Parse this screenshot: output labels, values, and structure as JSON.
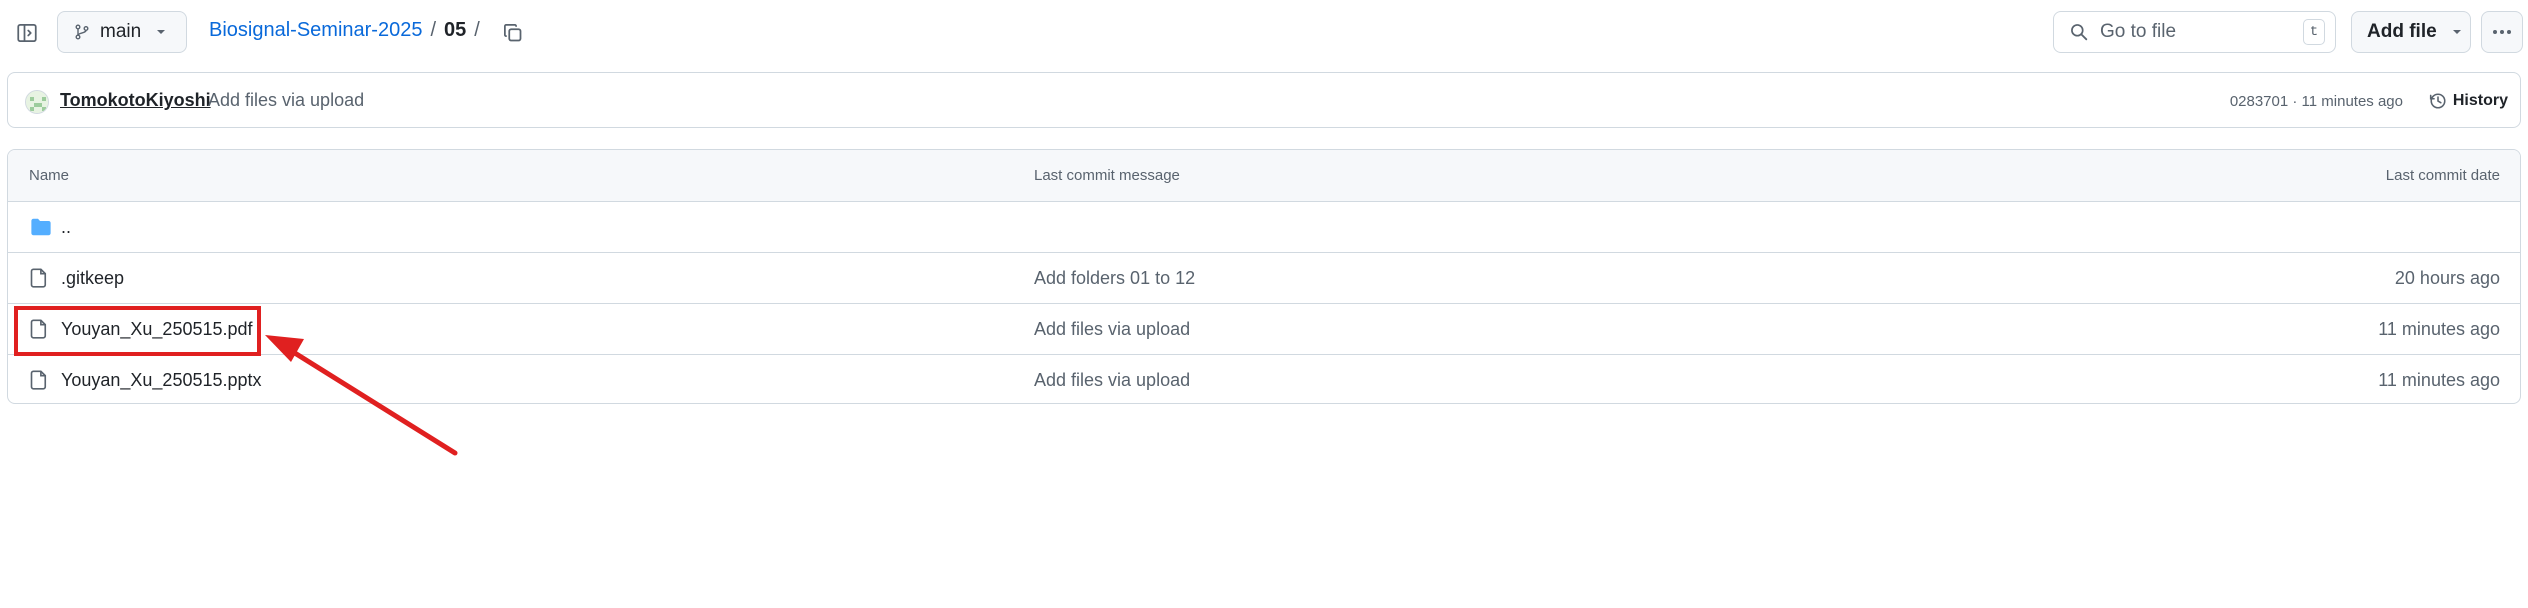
{
  "topbar": {
    "sidebar_toggle_icon": "sidebar-expand-icon",
    "branch": {
      "icon": "git-branch-icon",
      "label": "main"
    },
    "breadcrumb": {
      "repo": "Biosignal-Seminar-2025",
      "sep1": "/",
      "folder": "05",
      "sep2": "/"
    },
    "copy_icon": "copy-icon",
    "go_to_file": {
      "placeholder": "Go to file",
      "shortcut": "t"
    },
    "add_file": {
      "label": "Add file"
    },
    "more_icon": "kebab-horizontal-icon"
  },
  "commit": {
    "author": "TomokotoKiyoshi",
    "message": "Add files via upload",
    "meta": "0283701 · 11 minutes ago",
    "history_label": "History"
  },
  "table": {
    "headers": {
      "name": "Name",
      "message": "Last commit message",
      "date": "Last commit date"
    },
    "rows": [
      {
        "type": "folder",
        "name": "..",
        "message": "",
        "date": ""
      },
      {
        "type": "file",
        "name": ".gitkeep",
        "message": "Add folders 01 to 12",
        "date": "20 hours ago"
      },
      {
        "type": "file",
        "name": "Youyan_Xu_250515.pdf",
        "message": "Add files via upload",
        "date": "11 minutes ago"
      },
      {
        "type": "file",
        "name": "Youyan_Xu_250515.pptx",
        "message": "Add files via upload",
        "date": "11 minutes ago"
      }
    ]
  },
  "annotation": {
    "color": "#e02020",
    "target": "Youyan_Xu_250515.pdf"
  },
  "colors": {
    "link": "#0969da",
    "border": "#d1d9e0",
    "muted": "#59636e",
    "folder": "#54aeff"
  }
}
